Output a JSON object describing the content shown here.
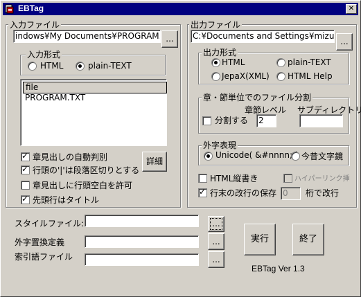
{
  "window": {
    "title": "EBTag",
    "close_symbol": "✕"
  },
  "input": {
    "group_title": "入力ファイル",
    "path_value": "indows¥My Documents¥PROGRAM.TXT",
    "browse_label": "...",
    "format": {
      "title": "入力形式",
      "options": [
        "HTML",
        "plain-TEXT"
      ],
      "selected": "plain-TEXT"
    },
    "file_list": {
      "header": "file",
      "items": [
        "PROGRAM.TXT"
      ]
    },
    "options": [
      {
        "label": "章見出しの自動判別",
        "checked": true
      },
      {
        "label": "行頭の'|'は段落区切りとする",
        "checked": true
      },
      {
        "label": "章見出しに行頭空白を許可",
        "checked": false
      },
      {
        "label": "先頭行はタイトル",
        "checked": true
      }
    ],
    "detail_button": "詳細"
  },
  "output": {
    "group_title": "出力ファイル",
    "path_value": "C:¥Documents and Settings¥mizuno¥デ",
    "browse_label": "...",
    "format": {
      "title": "出力形式",
      "options": [
        "HTML",
        "plain-TEXT",
        "JepaX(XML)",
        "HTML Help"
      ],
      "selected": "HTML"
    },
    "split": {
      "title": "章・節単位でのファイル分割",
      "level_label": "章節レベル",
      "subdir_label": "サブディレクトリ名",
      "split_label": "分割する",
      "split_checked": false,
      "level_value": "2",
      "subdir_value": ""
    },
    "gaiji": {
      "title": "外字表現",
      "options": [
        "Unicode( &#nnnn; )",
        "今昔文字鏡"
      ],
      "selected": "Unicode( &#nnnn; )"
    },
    "vertical": {
      "label": "HTML縦書き",
      "checked": false
    },
    "hyperlink": {
      "label": "ハイパーリンク挿入",
      "checked": false
    },
    "keep_newline": {
      "label": "行末の改行の保存",
      "checked": true
    },
    "wrap_value": "0",
    "wrap_label": "桁で改行"
  },
  "files": [
    {
      "label": "スタイルファイル:",
      "value": "",
      "browse": "..."
    },
    {
      "label": "外字置換定義",
      "value": "",
      "browse": "..."
    },
    {
      "label": "索引語ファイル",
      "value": "",
      "browse": "..."
    }
  ],
  "actions": {
    "run": "実行",
    "exit": "終了"
  },
  "version": "EBTag Ver 1.3"
}
